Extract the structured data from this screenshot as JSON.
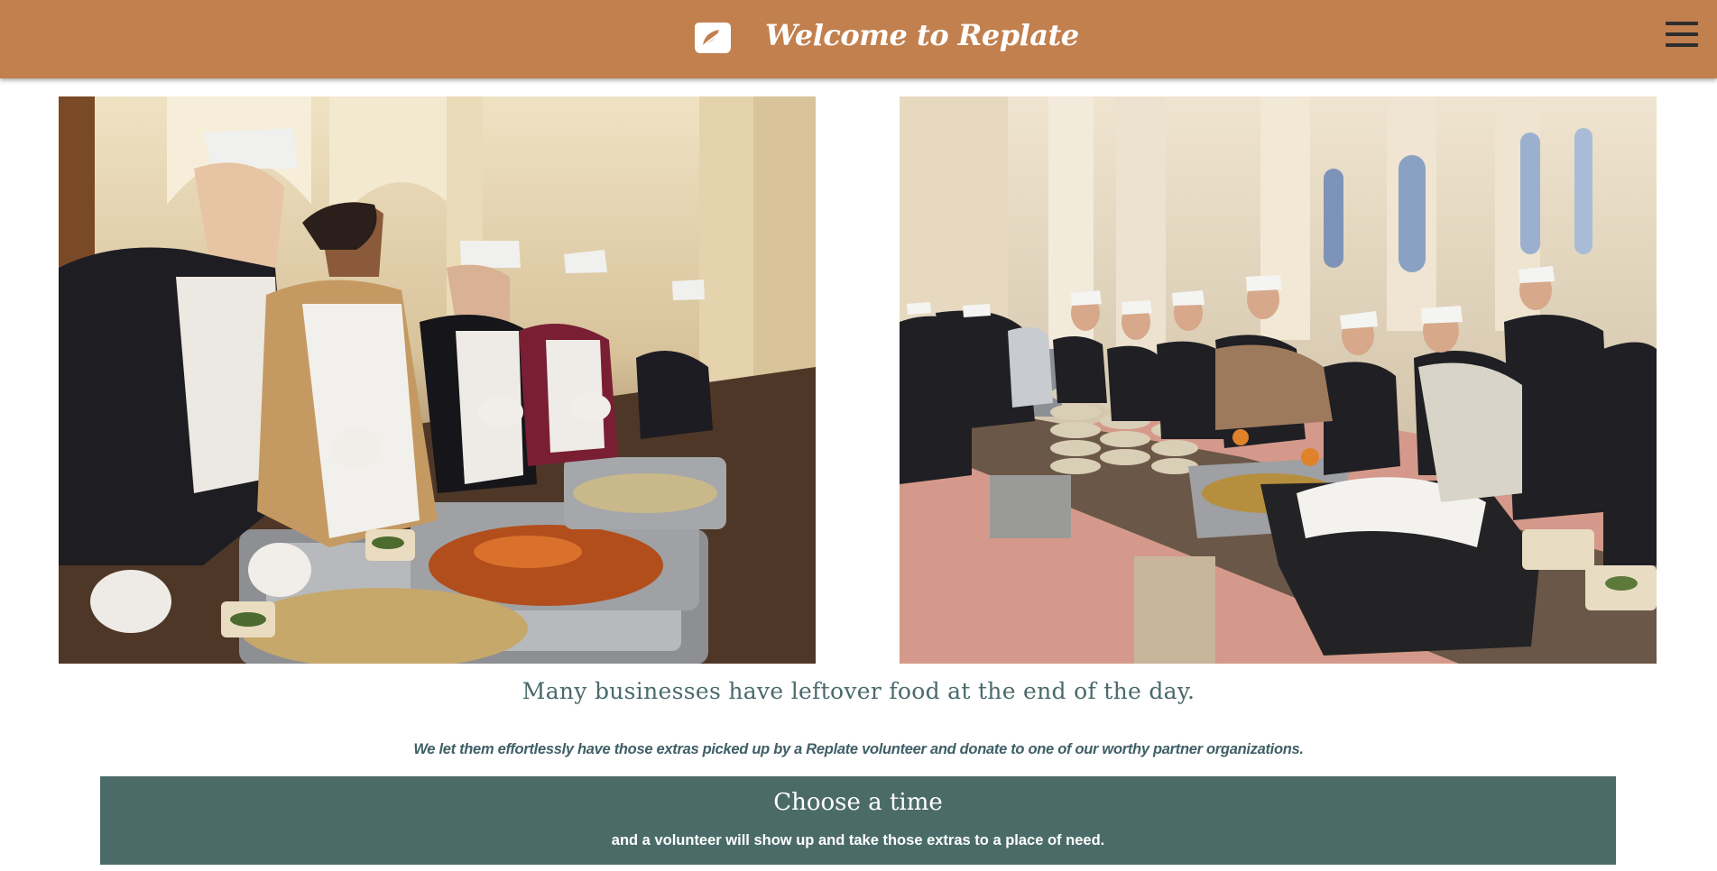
{
  "header": {
    "brand": "Welcome to Replate",
    "logo_icon": "replate-leaf-logo-icon",
    "menu_icon": "hamburger-menu-icon",
    "background": "#c2804f"
  },
  "photos": [
    {
      "subject": "volunteers serving food in a church hall"
    },
    {
      "subject": "smiling volunteers behind serving tables"
    }
  ],
  "intro": {
    "headline": "Many businesses have leftover food at the end of the day.",
    "description": "We let them effortlessly have those extras picked up by a Replate volunteer and donate to one of our worthy partner organizations."
  },
  "cta": {
    "title": "Choose a time",
    "subtitle": "and a volunteer will show up and take those extras to a place of need.",
    "background": "#4b6b69"
  }
}
